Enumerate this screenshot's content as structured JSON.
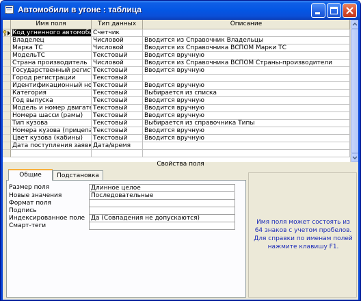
{
  "window": {
    "title": "Автомобили в угоне : таблица"
  },
  "grid": {
    "columns": [
      "Имя поля",
      "Тип данных",
      "Описание"
    ],
    "rows": [
      {
        "name": "Код угненного автомобиля",
        "type": "Счетчик",
        "desc": ""
      },
      {
        "name": "Владелец",
        "type": "Числовой",
        "desc": "Вводится из Справочник Владельцы"
      },
      {
        "name": "Марка ТС",
        "type": "Числовой",
        "desc": "Вводится из Справочника ВСПОМ Марки ТС"
      },
      {
        "name": "МодельТС",
        "type": "Текстовый",
        "desc": "Вводится вручную"
      },
      {
        "name": "Страна производитель",
        "type": "Числовой",
        "desc": "Вводится из Справочника ВСПОМ Страны-производители"
      },
      {
        "name": "Государственный регистра",
        "type": "Текстовый",
        "desc": "Вводится вручную"
      },
      {
        "name": "Город регистрации",
        "type": "Текстовый",
        "desc": ""
      },
      {
        "name": "Идентификационный номер",
        "type": "Текстовый",
        "desc": "Вводится вручную"
      },
      {
        "name": "Категория",
        "type": "Текстовый",
        "desc": "Выбирается из списка"
      },
      {
        "name": "Год выпуска",
        "type": "Текстовый",
        "desc": "Вводится вручную"
      },
      {
        "name": "Модель и номер двигателя",
        "type": "Текстовый",
        "desc": "Вводится вручную"
      },
      {
        "name": "Номера шасси (рамы)",
        "type": "Текстовый",
        "desc": "Вводится вручную"
      },
      {
        "name": "Тип кузова",
        "type": "Текстовый",
        "desc": "Выбирается из справочника Типы"
      },
      {
        "name": "Номера кузова (прицепа)",
        "type": "Текстовый",
        "desc": "Вводится вручную"
      },
      {
        "name": "Цвет кузова (кабины)",
        "type": "Текстовый",
        "desc": "Вводится вручную"
      },
      {
        "name": "Дата поступления заявки о",
        "type": "Дата/время",
        "desc": ""
      }
    ]
  },
  "field_properties": {
    "label": "Свойства поля",
    "tabs": [
      "Общие",
      "Подстановка"
    ],
    "properties": [
      {
        "label": "Размер поля",
        "value": "Длинное целое"
      },
      {
        "label": "Новые значения",
        "value": "Последовательные"
      },
      {
        "label": "Формат поля",
        "value": ""
      },
      {
        "label": "Подпись",
        "value": ""
      },
      {
        "label": "Индексированное поле",
        "value": "Да (Совпадения не допускаются)"
      },
      {
        "label": "Смарт-теги",
        "value": ""
      }
    ],
    "help_text": "Имя поля может состоять из 64 знаков с учетом пробелов.  Для справки по именам полей нажмите клавишу F1."
  },
  "icons": [
    "table-icon",
    "minimize-icon",
    "maximize-icon",
    "close-icon",
    "primary-key-icon",
    "row-selector-arrow-icon",
    "scroll-up-icon",
    "scroll-down-icon"
  ],
  "colors": {
    "titlebar": "#0456e4",
    "window_face": "#ece9d8",
    "help_text": "#1a2ab8",
    "active_tab_accent": "#f9b03a"
  }
}
